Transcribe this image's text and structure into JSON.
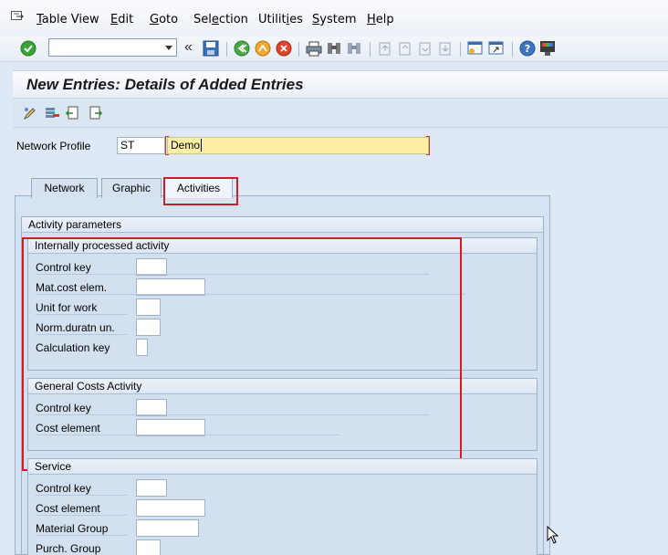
{
  "menu": {
    "items": [
      {
        "key": "table_view",
        "pre": "",
        "u": "T",
        "post": "able View"
      },
      {
        "key": "edit",
        "pre": "",
        "u": "E",
        "post": "dit"
      },
      {
        "key": "goto",
        "pre": "",
        "u": "G",
        "post": "oto"
      },
      {
        "key": "selection",
        "pre": "Sel",
        "u": "e",
        "post": "ction"
      },
      {
        "key": "utilities",
        "pre": "Utilit",
        "u": "i",
        "post": "es"
      },
      {
        "key": "system",
        "pre": "",
        "u": "S",
        "post": "ystem"
      },
      {
        "key": "help",
        "pre": "",
        "u": "H",
        "post": "elp"
      }
    ]
  },
  "toolbar": {
    "command_value": "",
    "history_glyph": "«"
  },
  "title": "New Entries: Details of Added Entries",
  "header": {
    "network_profile_label": "Network Profile",
    "profile_code": "ST",
    "profile_name": "Demo"
  },
  "tabs": [
    {
      "label": "Network",
      "active": false
    },
    {
      "label": "Graphic",
      "active": false
    },
    {
      "label": "Activities",
      "active": true
    }
  ],
  "activity_parameters": {
    "title": "Activity parameters",
    "internal": {
      "title": "Internally processed activity",
      "fields": [
        {
          "label": "Control key",
          "value": ""
        },
        {
          "label": "Mat.cost elem.",
          "value": ""
        },
        {
          "label": "Unit for work",
          "value": ""
        },
        {
          "label": "Norm.duratn un.",
          "value": ""
        },
        {
          "label": "Calculation key",
          "value": ""
        }
      ]
    },
    "general_costs": {
      "title": "General Costs Activity",
      "fields": [
        {
          "label": "Control key",
          "value": ""
        },
        {
          "label": "Cost element",
          "value": ""
        }
      ]
    },
    "service": {
      "title": "Service",
      "fields": [
        {
          "label": "Control key",
          "value": ""
        },
        {
          "label": "Cost element",
          "value": ""
        },
        {
          "label": "Material Group",
          "value": ""
        },
        {
          "label": "Purch. Group",
          "value": ""
        }
      ]
    }
  },
  "colors": {
    "highlight_red": "#cc1e25",
    "active_input_yellow": "#fdf0a5",
    "panel_blue": "#d6e3f2"
  }
}
